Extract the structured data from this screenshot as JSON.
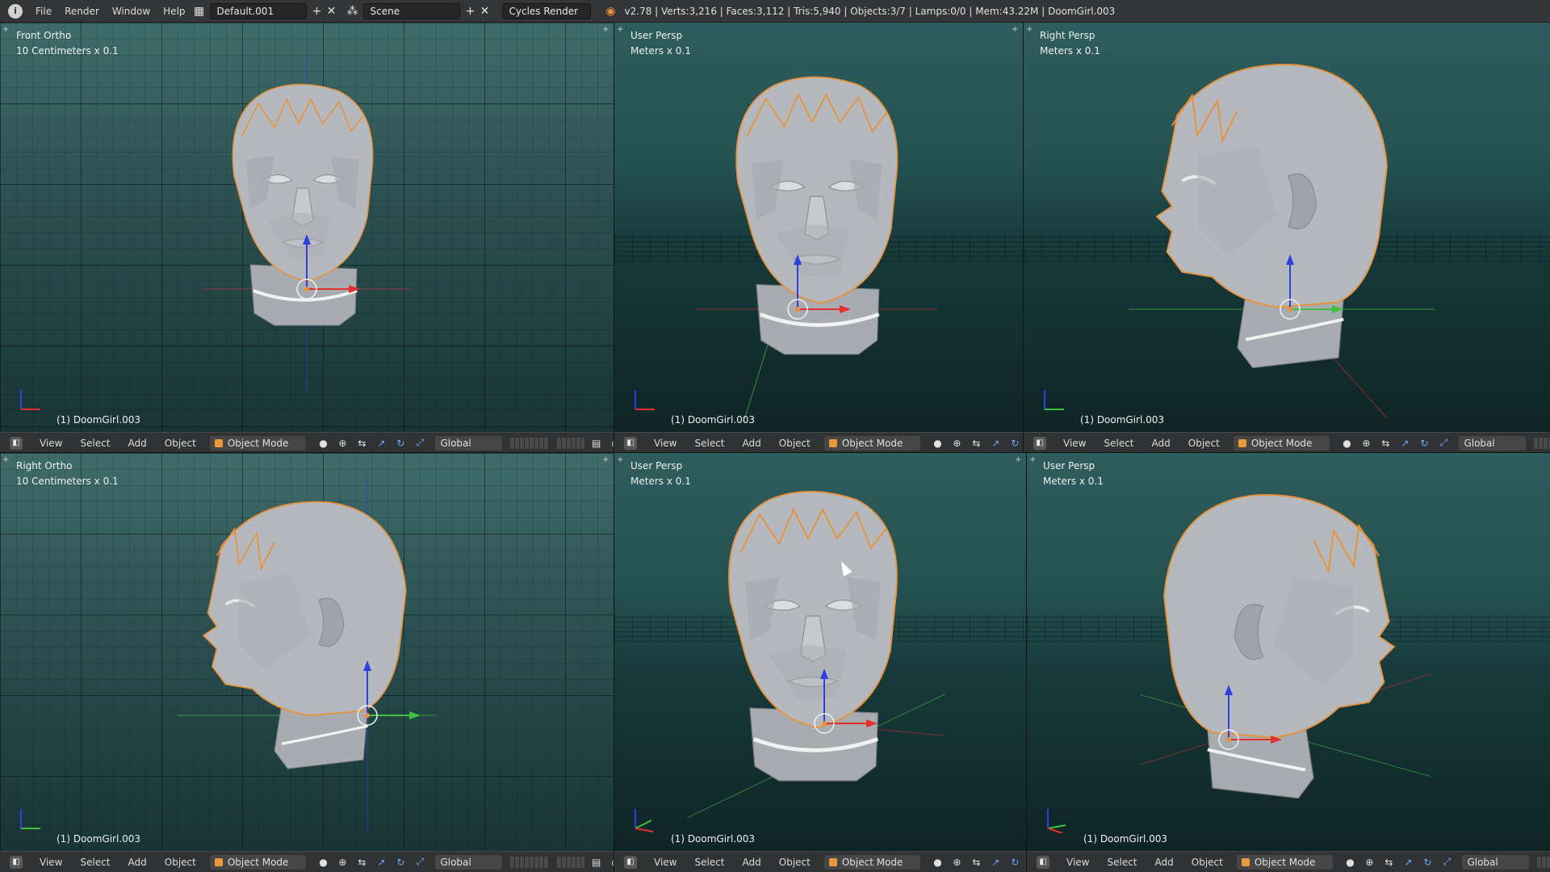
{
  "topbar": {
    "menu": [
      "File",
      "Render",
      "Window",
      "Help"
    ],
    "screen_layout": "Default.001",
    "scene": "Scene",
    "render_engine": "Cycles Render",
    "stats": "v2.78 | Verts:3,216 | Faces:3,112 | Tris:5,940 | Objects:3/7 | Lamps:0/0 | Mem:43.22M | DoomGirl.003"
  },
  "viewports": [
    {
      "title": "Front Ortho",
      "scale": "10 Centimeters x 0.1",
      "object": "(1) DoomGirl.003",
      "view": "front",
      "projection": "ortho"
    },
    {
      "title": "User Persp",
      "scale": "Meters x 0.1",
      "object": "(1) DoomGirl.003",
      "view": "front",
      "projection": "persp"
    },
    {
      "title": "Right Persp",
      "scale": "Meters x 0.1",
      "object": "(1) DoomGirl.003",
      "view": "side",
      "projection": "persp"
    },
    {
      "title": "Right Ortho",
      "scale": "10 Centimeters x 0.1",
      "object": "(1) DoomGirl.003",
      "view": "side",
      "projection": "ortho"
    },
    {
      "title": "User Persp",
      "scale": "Meters x 0.1",
      "object": "(1) DoomGirl.003",
      "view": "three-quarter",
      "projection": "persp"
    },
    {
      "title": "User Persp",
      "scale": "Meters x 0.1",
      "object": "(1) DoomGirl.003",
      "view": "three-quarter-right",
      "projection": "persp"
    }
  ],
  "header": {
    "menu": [
      "View",
      "Select",
      "Add",
      "Object"
    ],
    "mode": "Object Mode",
    "orientation": "Global"
  },
  "colors": {
    "viewport_top": "#3f6c6a",
    "viewport_bottom": "#183436",
    "selection": "#e8913a",
    "x_axis": "#e03030",
    "y_axis": "#40c040",
    "z_axis": "#2f3fe0"
  }
}
